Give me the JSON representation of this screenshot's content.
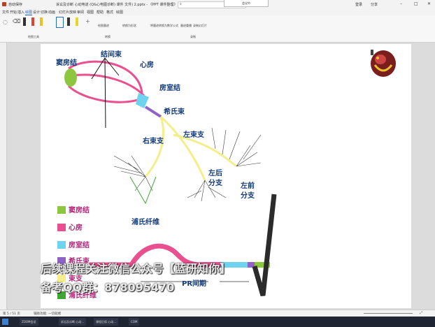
{
  "window": {
    "title": "诉讼及诊断 心动电道 (Q&心电图诊断) 课件 文件) 2.pptx - 《PPT 课件整理》",
    "user": "登录",
    "share": "分享",
    "meeting_label": "会议中"
  },
  "menu": [
    "文件",
    "开始",
    "插入",
    "绘图",
    "设计",
    "切换",
    "动画",
    "幻灯片放映",
    "审阅",
    "视图",
    "帮助",
    "格式",
    "绘图"
  ],
  "ribbon": {
    "groups": [
      "绘图工具",
      "绘制",
      "转换",
      "录制"
    ],
    "tools": [
      "绘图墨迹",
      "转换为形状",
      "将墨迹转换为数学公式",
      "墨迹重播",
      "录制幻灯片"
    ]
  },
  "diagram": {
    "labels": {
      "sinus_node": "窦房结",
      "internodal": "结间束",
      "atrium": "心房",
      "av_node": "房室结",
      "his_bundle": "希氏束",
      "right_branch": "右束支",
      "left_branch": "左束支",
      "left_posterior_1": "左后",
      "left_posterior_2": "分支",
      "left_anterior_1": "左前",
      "left_anterior_2": "分支",
      "purkinje": "浦氏纤维",
      "pr_interval": "PR间期"
    },
    "legend": [
      {
        "color": "#8dc63f",
        "label": "窦房结"
      },
      {
        "color": "#e8508f",
        "label": "心房"
      },
      {
        "color": "#6ed3ee",
        "label": "房室结"
      },
      {
        "color": "#8f62c7",
        "label": "希氏束"
      },
      {
        "color": "#f4ee8c",
        "label": "束支"
      },
      {
        "color": "#3fa535",
        "label": "浦氏纤维"
      }
    ]
  },
  "watermark": {
    "line1": "后续课程关注微信公众号【蓝研知你】",
    "line2": "备考QQ群：878095470"
  },
  "status": {
    "slide": "第 5 / 51 页",
    "note": "辅助功能: 一切就绪"
  },
  "taskbar": {
    "items": [
      "ZOOM会议",
      "诉讼及诊断 心动...",
      "课程后续 心动...",
      "COM"
    ]
  }
}
